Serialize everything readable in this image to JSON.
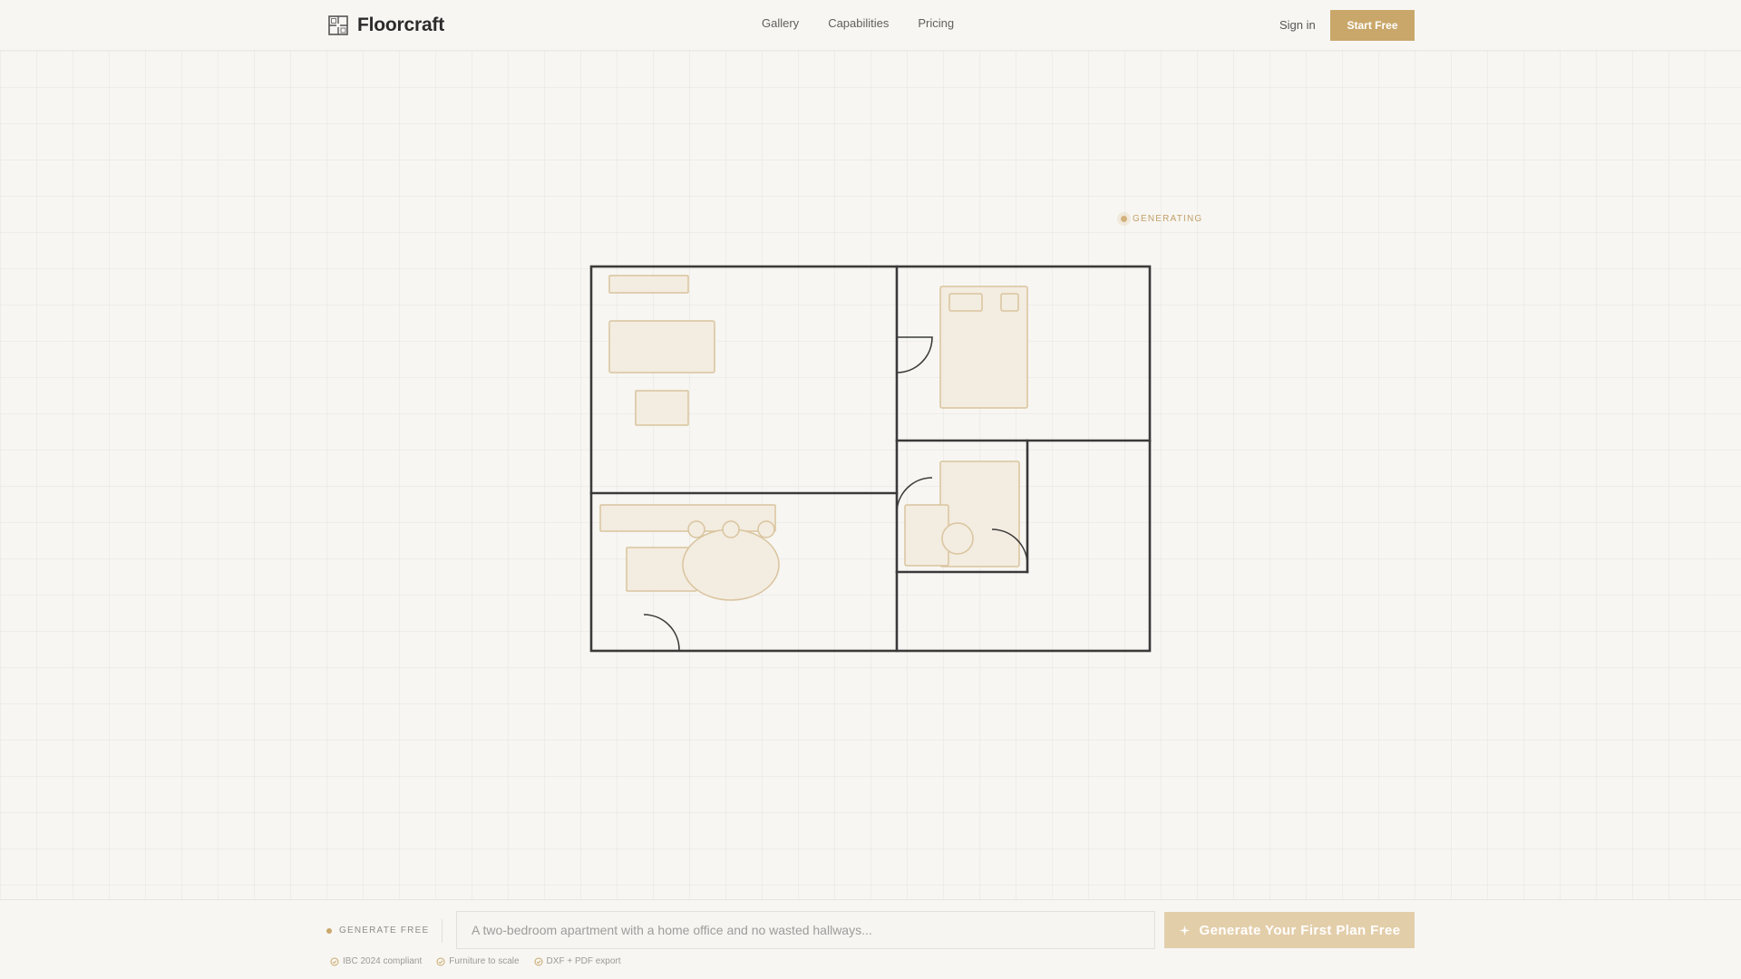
{
  "brand": {
    "name": "Floorcraft",
    "logo_icon": "floorplan-logo-icon"
  },
  "nav": {
    "items": [
      "Gallery",
      "Capabilities",
      "Pricing"
    ]
  },
  "header": {
    "signin_label": "Sign in",
    "start_label": "Start Free"
  },
  "status": {
    "label": "GENERATING"
  },
  "bottom": {
    "label": "GENERATE FREE",
    "prompt_placeholder": "A two-bedroom apartment with a home office and no wasted hallways...",
    "prompt_value": "",
    "button_label": "Generate Your First Plan Free",
    "button_icon": "sparkle-icon",
    "features": [
      "IBC 2024 compliant",
      "Furniture to scale",
      "DXF + PDF export"
    ]
  },
  "colors": {
    "accent": "#c9a76a",
    "accent_light": "#e3ceaa",
    "wall": "#3a3a3a",
    "furniture_stroke": "#d9c49e",
    "furniture_fill": "#f3ece0"
  }
}
